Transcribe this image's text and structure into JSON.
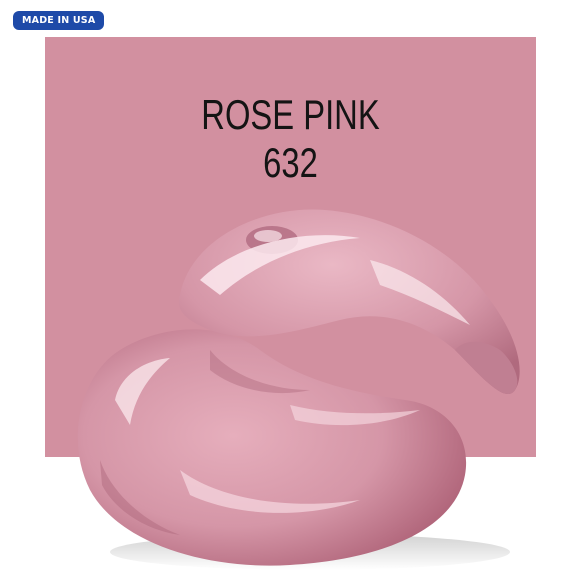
{
  "badge": {
    "label": "MADE IN USA"
  },
  "product": {
    "color_name": "ROSE PINK",
    "color_code": "632"
  },
  "colors": {
    "swatch": "#d290a0",
    "paint_base": "#d898a8",
    "paint_shadow": "#b36a7e",
    "paint_highlight": "#f8e4ea",
    "badge": "#1e4aa8"
  }
}
